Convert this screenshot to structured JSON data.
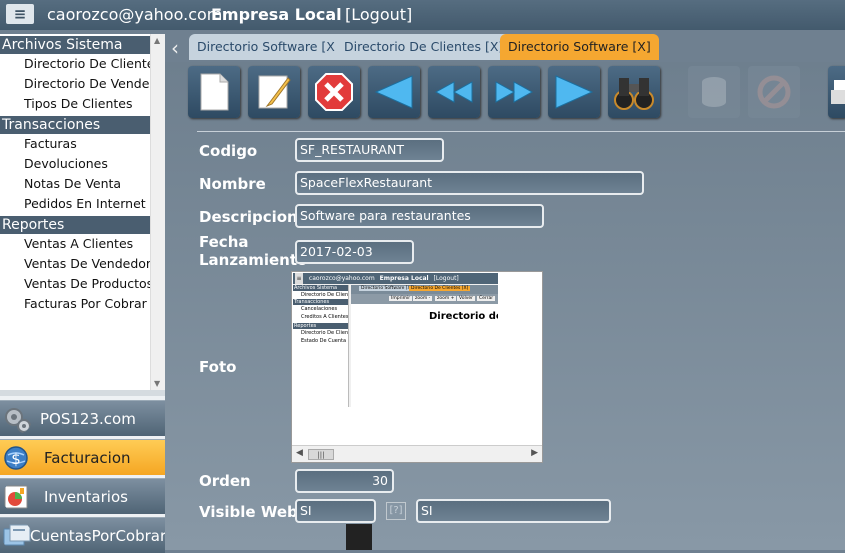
{
  "topbar": {
    "menu_icon": "≡",
    "email": "caorozco@yahoo.com",
    "company": "Empresa Local",
    "logout": "[Logout]"
  },
  "sidebar": {
    "sections": [
      {
        "title": "Archivos Sistema",
        "items": [
          "Directorio De Clientes",
          "Directorio De Vendedores",
          "Tipos De Clientes"
        ]
      },
      {
        "title": "Transacciones",
        "items": [
          "Facturas",
          "Devoluciones",
          "Notas De Venta",
          "Pedidos En Internet"
        ]
      },
      {
        "title": "Reportes",
        "items": [
          "Ventas A Clientes",
          "Ventas De Vendedores",
          "Ventas De Productos",
          "Facturas Por Cobrar"
        ]
      }
    ],
    "modules": [
      {
        "label": "POS123.com",
        "icon": "gears-icon"
      },
      {
        "label": "Facturacion",
        "icon": "globe-icon"
      },
      {
        "label": "Inventarios",
        "icon": "chart-icon"
      },
      {
        "label": "CuentasPorCobrar",
        "icon": "folders-icon"
      }
    ]
  },
  "tabs": [
    {
      "label": "Directorio Software [X]",
      "active": false
    },
    {
      "label": "Directorio De Clientes [X]",
      "active": false
    },
    {
      "label": "Directorio Software [X]",
      "active": true
    }
  ],
  "form": {
    "codigo_label": "Codigo",
    "codigo_value": "SF_RESTAURANT",
    "nombre_label": "Nombre",
    "nombre_value": "SpaceFlexRestaurant",
    "descripcion_label": "Descripcion",
    "descripcion_value": "Software para restaurantes",
    "fecha_label_1": "Fecha",
    "fecha_label_2": "Lanzamiento",
    "fecha_value": "2017-02-03",
    "foto_label": "Foto",
    "orden_label": "Orden",
    "orden_value": "30",
    "visible_label": "Visible Web",
    "visible_value": "SI",
    "visible_help": "[?]",
    "visible_value2": "SI"
  },
  "thumbnail": {
    "email": "caorozco@yahoo.com",
    "company": "Empresa Local",
    "logout": "[Logout]",
    "sections": [
      {
        "title": "Archivos Sistema",
        "items": [
          "Directorio De Clientes"
        ]
      },
      {
        "title": "Transacciones",
        "items": [
          "Cancelaciones",
          "Creditos A Clientes"
        ]
      },
      {
        "title": "Reportes",
        "items": [
          "Directorio De Clientes",
          "Estado De Cuenta De"
        ]
      }
    ],
    "tabs": [
      "Directorio Software [X]",
      "Directorio De Clientes [X]"
    ],
    "buttons": [
      "Imprimir",
      "zoom -",
      "zoom +",
      "Volver",
      "Cerrar"
    ],
    "heading": "Directorio de C",
    "scroll_thumb": "|||"
  },
  "colors": {
    "accent": "#f5a731",
    "header": "#4a5e70",
    "toolbar": "#2e4a62"
  }
}
